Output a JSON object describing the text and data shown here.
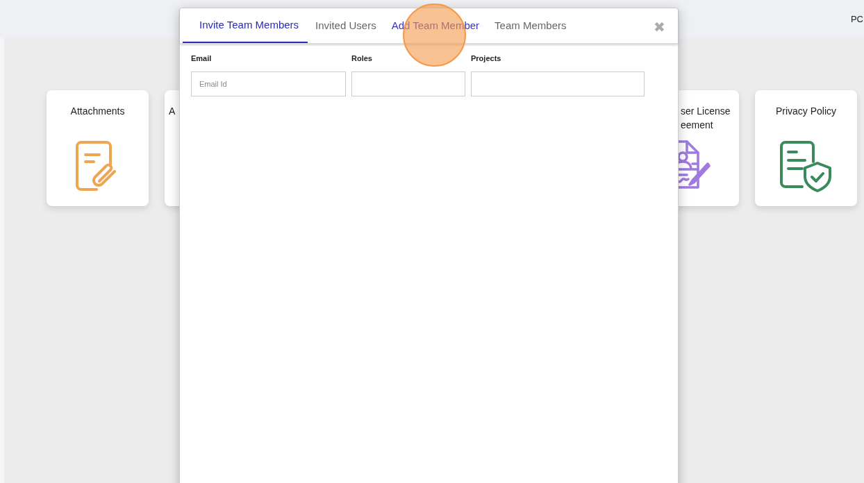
{
  "header": {
    "user_initials": "PC"
  },
  "cards": [
    {
      "kind": "attachments",
      "title": "Attachments"
    },
    {
      "kind": "partial-left",
      "title": "A"
    },
    {
      "kind": "hidden"
    },
    {
      "kind": "hidden"
    },
    {
      "kind": "hidden"
    },
    {
      "kind": "license",
      "title_lines": [
        "ser License",
        "eement"
      ]
    },
    {
      "kind": "privacy",
      "title": "Privacy Policy"
    }
  ],
  "modal": {
    "tabs": [
      {
        "label": "Invite Team Members",
        "selected": true,
        "highlighted": false
      },
      {
        "label": "Invited Users",
        "selected": false,
        "highlighted": false
      },
      {
        "label": "Add Team Member",
        "selected": false,
        "highlighted": true
      },
      {
        "label": "Team Members",
        "selected": false,
        "highlighted": false
      }
    ],
    "close": "✖",
    "fields": [
      {
        "label": "Email",
        "placeholder": "Email Id"
      },
      {
        "label": "Roles"
      },
      {
        "label": "Projects"
      }
    ]
  },
  "click_indicator": {
    "visible": true
  }
}
